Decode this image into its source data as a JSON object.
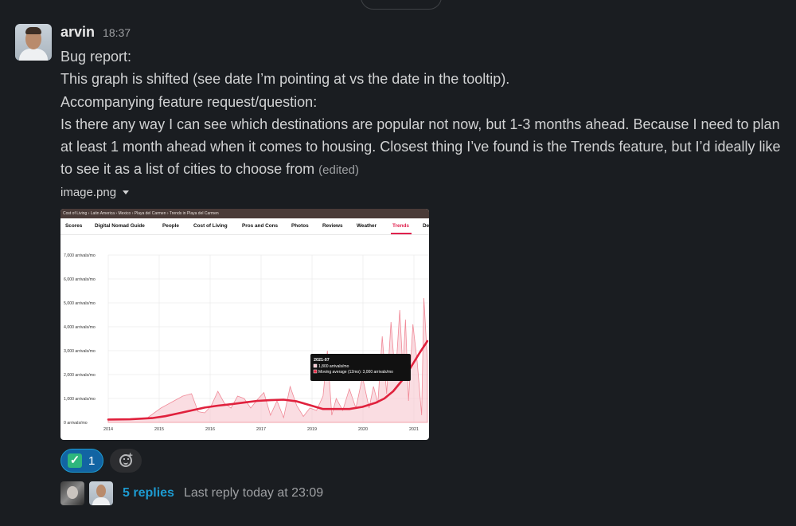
{
  "message": {
    "author": "arvin",
    "time": "18:37",
    "lines": [
      "Bug report:",
      "This graph is shifted (see date I’m pointing at vs the date in the tooltip).",
      "Accompanying feature request/question:",
      "Is there any way I can see which destinations are popular not now, but 1-3 months ahead. Because I need to plan at least 1 month ahead when it comes to housing. Closest thing I’ve found is the Trends feature, but I’d ideally like to see it as a list of cities to choose from"
    ],
    "edited": "(edited)"
  },
  "attachment": {
    "filename": "image.png",
    "breadcrumb": "Cost of Living › Latin America › Mexico › Playa del Carmen › Trends in Playa del Carmen",
    "tabs": [
      "Scores",
      "Digital Nomad Guide",
      "People",
      "Cost of Living",
      "Pros and Cons",
      "Photos",
      "Reviews",
      "Weather",
      "Trends",
      "De"
    ],
    "active_tab": "Trends",
    "tooltip": {
      "title": "2021-07",
      "line1": "1,800 arrivals/mo",
      "line2": "Moving average (12mo): 3,000 arrivals/mo"
    }
  },
  "chart_data": {
    "type": "area",
    "y_ticks": [
      "0 arrivals/mo",
      "1,000 arrivals/mo",
      "2,000 arrivals/mo",
      "3,000 arrivals/mo",
      "4,000 arrivals/mo",
      "5,000 arrivals/mo",
      "6,000 arrivals/mo",
      "7,000 arrivals/mo"
    ],
    "x_ticks": [
      "2014",
      "2015",
      "2016",
      "2017",
      "2019",
      "2020",
      "2021"
    ],
    "ylim": [
      0,
      7000
    ],
    "xlim": [
      2014,
      2021.3
    ],
    "grid": true,
    "series": [
      {
        "color": "#f08a98",
        "x": [
          2014.0,
          2014.3,
          2014.6,
          2014.9,
          2015.2,
          2015.5,
          2015.7,
          2015.9,
          2016.05,
          2016.2,
          2016.35,
          2016.5,
          2016.65,
          2016.8,
          2016.95,
          2017.1,
          2017.25,
          2017.4,
          2017.55,
          2017.7,
          2017.85,
          2018.0,
          2018.15,
          2018.3,
          2018.45,
          2018.6,
          2018.75,
          2018.9,
          2019.0,
          2019.1,
          2019.2,
          2019.35,
          2019.5,
          2019.65,
          2019.8,
          2019.95,
          2020.05,
          2020.15,
          2020.25,
          2020.35,
          2020.45,
          2020.55,
          2020.65,
          2020.72,
          2020.78,
          2020.85,
          2020.95,
          2021.05,
          2021.15,
          2021.2,
          2021.28
        ],
        "values": [
          100,
          150,
          120,
          200,
          600,
          900,
          1100,
          1200,
          450,
          400,
          700,
          1300,
          800,
          600,
          1100,
          1000,
          600,
          950,
          1250,
          300,
          900,
          200,
          1500,
          700,
          250,
          600,
          500,
          1100,
          3000,
          300,
          1000,
          500,
          1400,
          600,
          1900,
          600,
          1500,
          800,
          3600,
          1200,
          4200,
          1800,
          4700,
          2200,
          4300,
          900,
          4100,
          2500,
          300,
          5200,
          2600
        ]
      },
      {
        "name": "Moving average (12mo)",
        "color": "#e0213d",
        "x": [
          2014.0,
          2014.5,
          2015.0,
          2015.3,
          2015.6,
          2015.9,
          2016.2,
          2016.5,
          2016.8,
          2017.1,
          2017.4,
          2017.7,
          2018.0,
          2018.3,
          2018.6,
          2018.9,
          2019.2,
          2019.5,
          2019.8,
          2020.1,
          2020.3,
          2020.5,
          2020.7,
          2020.9,
          2021.1,
          2021.28
        ],
        "values": [
          120,
          130,
          180,
          260,
          380,
          500,
          620,
          700,
          760,
          830,
          900,
          930,
          950,
          880,
          720,
          560,
          560,
          560,
          650,
          820,
          1000,
          1300,
          1750,
          2300,
          2900,
          3400
        ]
      }
    ]
  }
}
